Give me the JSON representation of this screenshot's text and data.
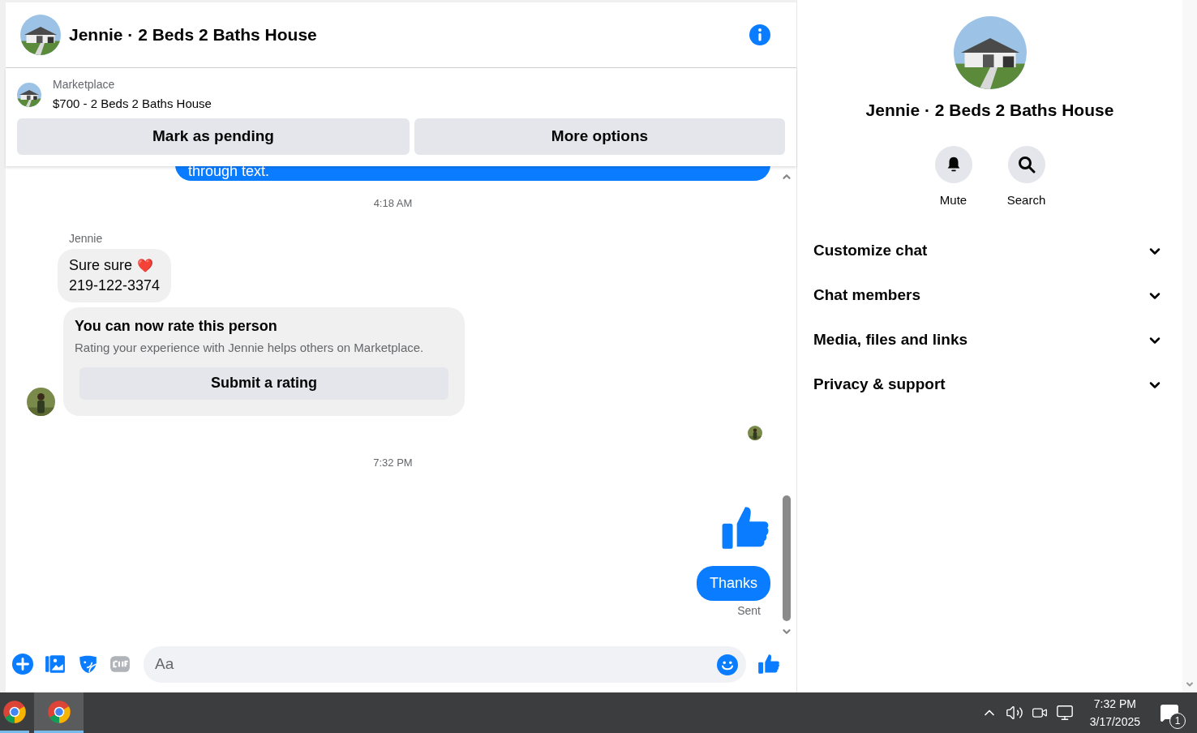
{
  "header": {
    "title": "Jennie · 2 Beds 2 Baths House"
  },
  "listing": {
    "source": "Marketplace",
    "title": "$700 - 2 Beds 2 Baths House"
  },
  "listing_actions": [
    "Mark as pending",
    "More options"
  ],
  "messages": [
    {
      "kind": "outgoing_text",
      "lines": [
        "through text."
      ]
    },
    {
      "kind": "timestamp",
      "text": "4:18 AM"
    },
    {
      "kind": "incoming_text",
      "sender": "Jennie",
      "lines": [
        "Sure sure",
        "219-122-3374"
      ],
      "emoji": "❤️"
    },
    {
      "kind": "rating_card",
      "title": "You can now rate this person",
      "body": "Rating your experience with Jennie helps others on Marketplace.",
      "button": "Submit a rating"
    },
    {
      "kind": "read_receipt"
    },
    {
      "kind": "timestamp",
      "text": "7:32 PM"
    },
    {
      "kind": "outgoing_like"
    },
    {
      "kind": "outgoing_text",
      "lines": [
        "Thanks"
      ],
      "status": "Sent"
    }
  ],
  "composer": {
    "placeholder": "Aa"
  },
  "details": {
    "title": "Jennie · 2 Beds 2 Baths House",
    "actions": [
      {
        "kind": "bell",
        "label": "Mute"
      },
      {
        "kind": "search",
        "label": "Search"
      }
    ],
    "sections": [
      {
        "label": "Customize chat",
        "expanded": false
      },
      {
        "label": "Chat members",
        "expanded": false
      },
      {
        "label": "Media, files and links",
        "expanded": false
      },
      {
        "label": "Privacy & support",
        "expanded": false
      }
    ]
  },
  "taskbar": {
    "time": "7:32 PM",
    "date": "3/17/2025",
    "notifications": "1",
    "apps": [
      {
        "selected": false
      },
      {
        "selected": true
      }
    ]
  }
}
